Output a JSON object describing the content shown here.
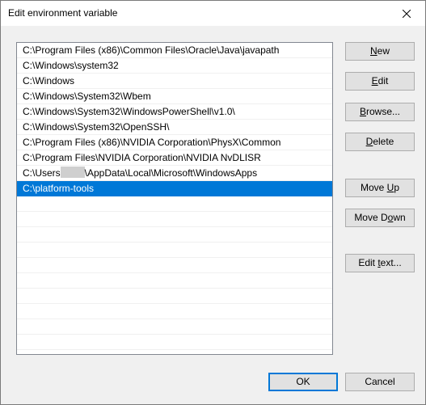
{
  "window": {
    "title": "Edit environment variable"
  },
  "list": {
    "items": [
      {
        "text": "C:\\Program Files (x86)\\Common Files\\Oracle\\Java\\javapath"
      },
      {
        "text": "C:\\Windows\\system32"
      },
      {
        "text": "C:\\Windows"
      },
      {
        "text": "C:\\Windows\\System32\\Wbem"
      },
      {
        "text": "C:\\Windows\\System32\\WindowsPowerShell\\v1.0\\"
      },
      {
        "text": "C:\\Windows\\System32\\OpenSSH\\"
      },
      {
        "text": "C:\\Program Files (x86)\\NVIDIA Corporation\\PhysX\\Common"
      },
      {
        "text": "C:\\Program Files\\NVIDIA Corporation\\NVIDIA NvDLISR"
      },
      {
        "text_before": "C:\\Users",
        "text_after": "\\AppData\\Local\\Microsoft\\WindowsApps"
      },
      {
        "text": "C:\\platform-tools",
        "selected": true
      }
    ]
  },
  "buttons": {
    "new": {
      "pre": "",
      "accel": "N",
      "post": "ew"
    },
    "edit": {
      "pre": "",
      "accel": "E",
      "post": "dit"
    },
    "browse": {
      "pre": "",
      "accel": "B",
      "post": "rowse..."
    },
    "delete": {
      "pre": "",
      "accel": "D",
      "post": "elete"
    },
    "move_up": {
      "pre": "Move ",
      "accel": "U",
      "post": "p"
    },
    "move_down": {
      "pre": "Move D",
      "accel": "o",
      "post": "wn"
    },
    "edit_text": {
      "pre": "Edit ",
      "accel": "t",
      "post": "ext..."
    },
    "ok": "OK",
    "cancel": "Cancel"
  },
  "colors": {
    "selection": "#0078d7",
    "default_button_border": "#0078d7"
  }
}
